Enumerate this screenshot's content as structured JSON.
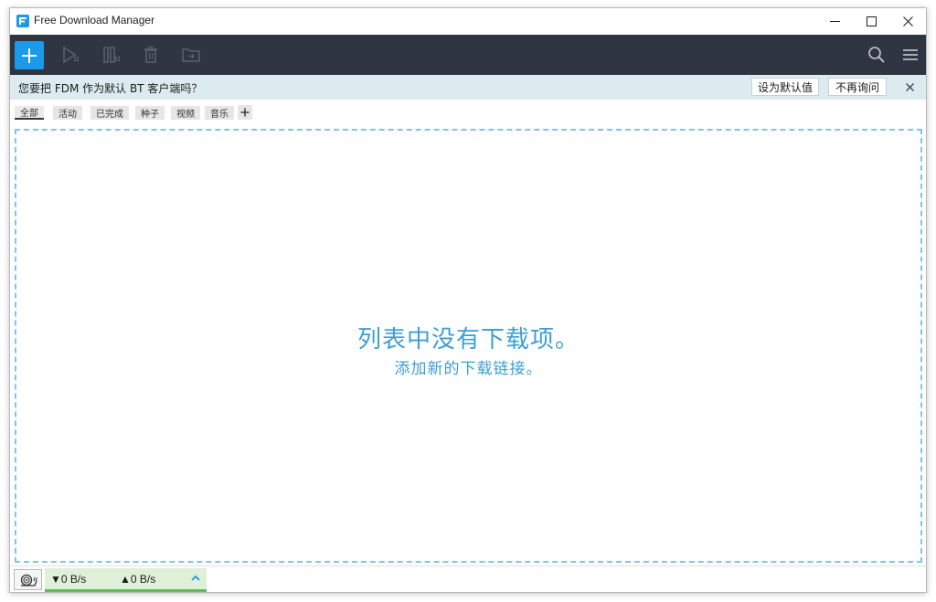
{
  "window": {
    "title": "Free Download Manager"
  },
  "toolbar": {
    "add_icon": "plus-icon",
    "icons": [
      "play-icon",
      "pause-icon",
      "trash-icon",
      "folder-move-icon",
      "search-icon",
      "hamburger-menu-icon"
    ],
    "accent_color": "#1a9ae8",
    "background_color": "#2f3541"
  },
  "notification": {
    "text": "您要把 FDM 作为默认 BT 客户端吗？",
    "set_default_label": "设为默认值",
    "dont_ask_label": "不再询问"
  },
  "tabs": [
    {
      "label": "全部",
      "active": true
    },
    {
      "label": "活动",
      "active": false
    },
    {
      "label": "已完成",
      "active": false
    },
    {
      "label": "种子",
      "active": false
    },
    {
      "label": "视频",
      "active": false
    },
    {
      "label": "音乐",
      "active": false
    }
  ],
  "empty_state": {
    "title": "列表中没有下载项。",
    "subtitle": "添加新的下载链接。",
    "color": "#3d9fd3"
  },
  "status": {
    "download_speed": "▼0 B/s",
    "upload_speed": "▲0 B/s"
  }
}
